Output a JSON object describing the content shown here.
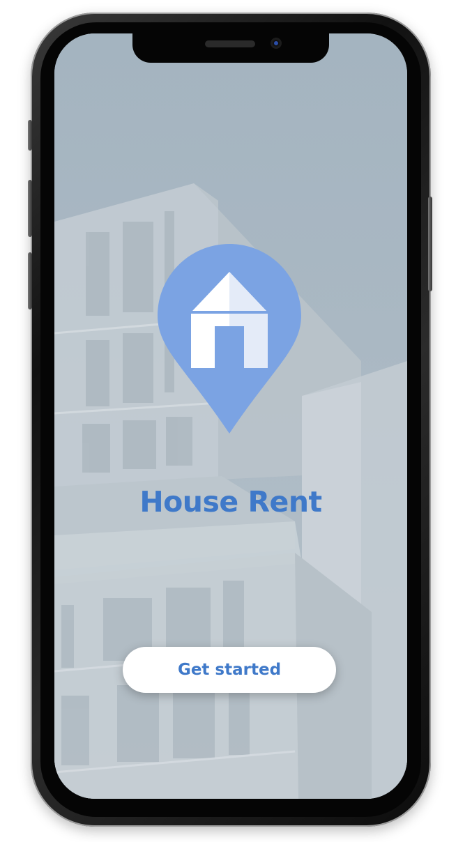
{
  "app": {
    "title": "House Rent"
  },
  "actions": {
    "get_started_label": "Get started"
  },
  "icons": {
    "logo": "map-pin-house-icon"
  },
  "colors": {
    "brand_blue": "#3f79c9",
    "pin_blue": "#7ba3e3",
    "button_bg": "#ffffff",
    "screen_bg": "#a9b7c2"
  }
}
